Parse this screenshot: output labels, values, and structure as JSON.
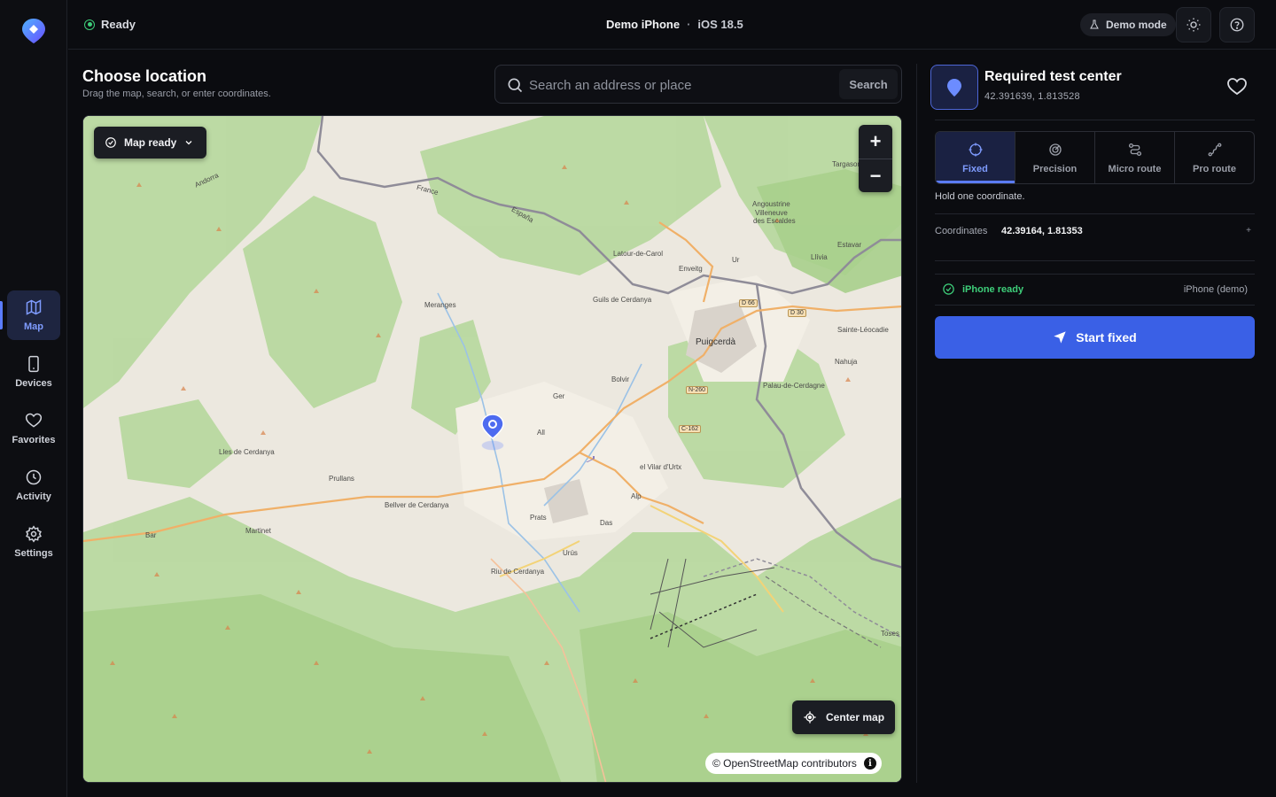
{
  "sidebar": {
    "items": [
      {
        "label": "Map",
        "icon": "map-icon",
        "active": true
      },
      {
        "label": "Devices",
        "icon": "phone-icon",
        "active": false
      },
      {
        "label": "Favorites",
        "icon": "heart-icon",
        "active": false
      },
      {
        "label": "Activity",
        "icon": "clock-icon",
        "active": false
      },
      {
        "label": "Settings",
        "icon": "gear-icon",
        "active": false
      }
    ]
  },
  "topbar": {
    "status": "Ready",
    "device_name": "Demo iPhone",
    "separator": "·",
    "os_version": "iOS 18.5",
    "demo_label": "Demo mode"
  },
  "main": {
    "title": "Choose location",
    "subtitle": "Drag the map, search, or enter coordinates.",
    "search": {
      "placeholder": "Search an address or place",
      "value": "",
      "button": "Search"
    }
  },
  "map": {
    "status_pill": "Map ready",
    "zoom_in": "+",
    "zoom_out": "−",
    "center_button": "Center map",
    "attribution": "© OpenStreetMap contributors",
    "attribution_info": "i",
    "places": [
      {
        "name": "Targasonne",
        "size": "small"
      },
      {
        "name": "Angoustrine",
        "size": "small"
      },
      {
        "name": "Villeneuve",
        "size": "small"
      },
      {
        "name": "des Escaldes",
        "size": "small"
      },
      {
        "name": "Estavar",
        "size": "small"
      },
      {
        "name": "Llívia",
        "size": "small"
      },
      {
        "name": "Latour-de-Carol",
        "size": "small"
      },
      {
        "name": "Enveitg",
        "size": "small"
      },
      {
        "name": "Ur",
        "size": "small"
      },
      {
        "name": "Guils de Cerdanya",
        "size": "small"
      },
      {
        "name": "Meranges",
        "size": "small"
      },
      {
        "name": "Puigcerdà",
        "size": "big"
      },
      {
        "name": "Sainte-Léocadie",
        "size": "small"
      },
      {
        "name": "Nahuja",
        "size": "small"
      },
      {
        "name": "Bolvir",
        "size": "small"
      },
      {
        "name": "Palau-de-Cerdagne",
        "size": "small"
      },
      {
        "name": "Ger",
        "size": "small"
      },
      {
        "name": "All",
        "size": "small"
      },
      {
        "name": "Lles de Cerdanya",
        "size": "small"
      },
      {
        "name": "el Vilar d'Urtx",
        "size": "small"
      },
      {
        "name": "Prullans",
        "size": "small"
      },
      {
        "name": "Bellver de Cerdanya",
        "size": "small"
      },
      {
        "name": "Alp",
        "size": "small"
      },
      {
        "name": "Prats",
        "size": "small"
      },
      {
        "name": "Martinet",
        "size": "small"
      },
      {
        "name": "Das",
        "size": "small"
      },
      {
        "name": "Bar",
        "size": "small"
      },
      {
        "name": "Urús",
        "size": "small"
      },
      {
        "name": "Riu de Cerdanya",
        "size": "small"
      },
      {
        "name": "Toses",
        "size": "small"
      },
      {
        "name": "Andorra",
        "size": "small"
      },
      {
        "name": "France",
        "size": "small"
      },
      {
        "name": "España",
        "size": "small"
      }
    ],
    "road_shields": [
      "D 66",
      "D 30",
      "N-260",
      "C-162"
    ]
  },
  "panel": {
    "location_name": "Required test center",
    "location_coords": "42.391639, 1.813528",
    "modes": [
      {
        "label": "Fixed",
        "icon": "crosshair-icon",
        "active": true
      },
      {
        "label": "Precision",
        "icon": "radar-icon",
        "active": false
      },
      {
        "label": "Micro route",
        "icon": "route-icon",
        "active": false
      },
      {
        "label": "Pro route",
        "icon": "path-icon",
        "active": false
      }
    ],
    "mode_description": "Hold one coordinate.",
    "coords_label": "Coordinates",
    "coords_value": "42.39164, 1.81353",
    "coords_plus": "+",
    "device_status": "iPhone ready",
    "device_name": "iPhone (demo)",
    "start_button": "Start fixed"
  },
  "colors": {
    "accent": "#5b7cff",
    "primary_button": "#3a60e6",
    "success": "#3ecf7a",
    "background": "#0b0c10"
  }
}
